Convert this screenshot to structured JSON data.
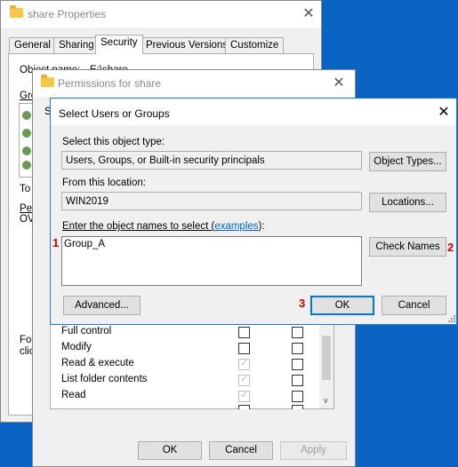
{
  "props": {
    "title": "share Properties",
    "tabs": [
      "General",
      "Sharing",
      "Security",
      "Previous Versions",
      "Customize"
    ],
    "object_name_label": "Object name:",
    "object_name_value": "E:\\share",
    "frag_gro": "Gro",
    "frag_to": "To",
    "frag_pe": "Pe",
    "frag_ov": "OV",
    "frag_fo": "Fo",
    "frag_cli": "clic"
  },
  "perms": {
    "title": "Permissions for share",
    "frag_se": "Se",
    "frag_g": "G",
    "rows": [
      "Full control",
      "Modify",
      "Read & execute",
      "List folder contents",
      "Read"
    ],
    "ok": "OK",
    "cancel": "Cancel",
    "apply": "Apply"
  },
  "select": {
    "title": "Select Users or Groups",
    "object_type_label": "Select this object type:",
    "object_type_value": "Users, Groups, or Built-in security principals",
    "object_types_button": "Object Types...",
    "location_label": "From this location:",
    "location_value": "WIN2019",
    "locations_button": "Locations...",
    "enter_names_label": "Enter the object names to select (",
    "examples_link": "examples",
    "enter_names_suffix": "):",
    "names_value": "Group_A",
    "check_names_button": "Check Names",
    "advanced_button": "Advanced...",
    "ok_button": "OK",
    "cancel_button": "Cancel"
  },
  "steps": [
    "1",
    "2",
    "3"
  ],
  "colors": {
    "desktop": "#0a63c2",
    "accent": "#0078d7",
    "link": "#0066cc",
    "step": "#cc0000"
  }
}
